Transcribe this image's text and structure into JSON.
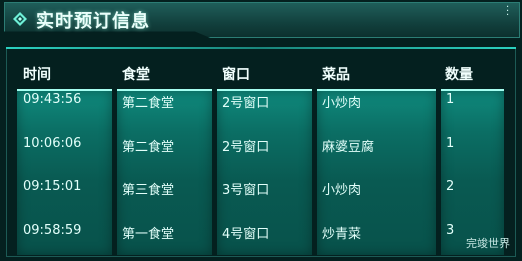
{
  "title": "实时预订信息",
  "columns": [
    "时间",
    "食堂",
    "窗口",
    "菜品",
    "数量"
  ],
  "rows": [
    [
      "09:43:56",
      "第二食堂",
      "2号窗口",
      "小炒肉",
      "1"
    ],
    [
      "10:06:06",
      "第二食堂",
      "2号窗口",
      "麻婆豆腐",
      "1"
    ],
    [
      "09:15:01",
      "第三食堂",
      "3号窗口",
      "小炒肉",
      "2"
    ],
    [
      "09:58:59",
      "第一食堂",
      "4号窗口",
      "炒青菜",
      "3"
    ]
  ],
  "watermark": "完竣世界",
  "icons": {
    "title_icon": "diamond-icon",
    "menu_icon": "more-vertical-icon"
  },
  "colors": {
    "accent": "#2bd1c0",
    "column_fill": "#0b6e64",
    "text": "#e2fffa"
  }
}
